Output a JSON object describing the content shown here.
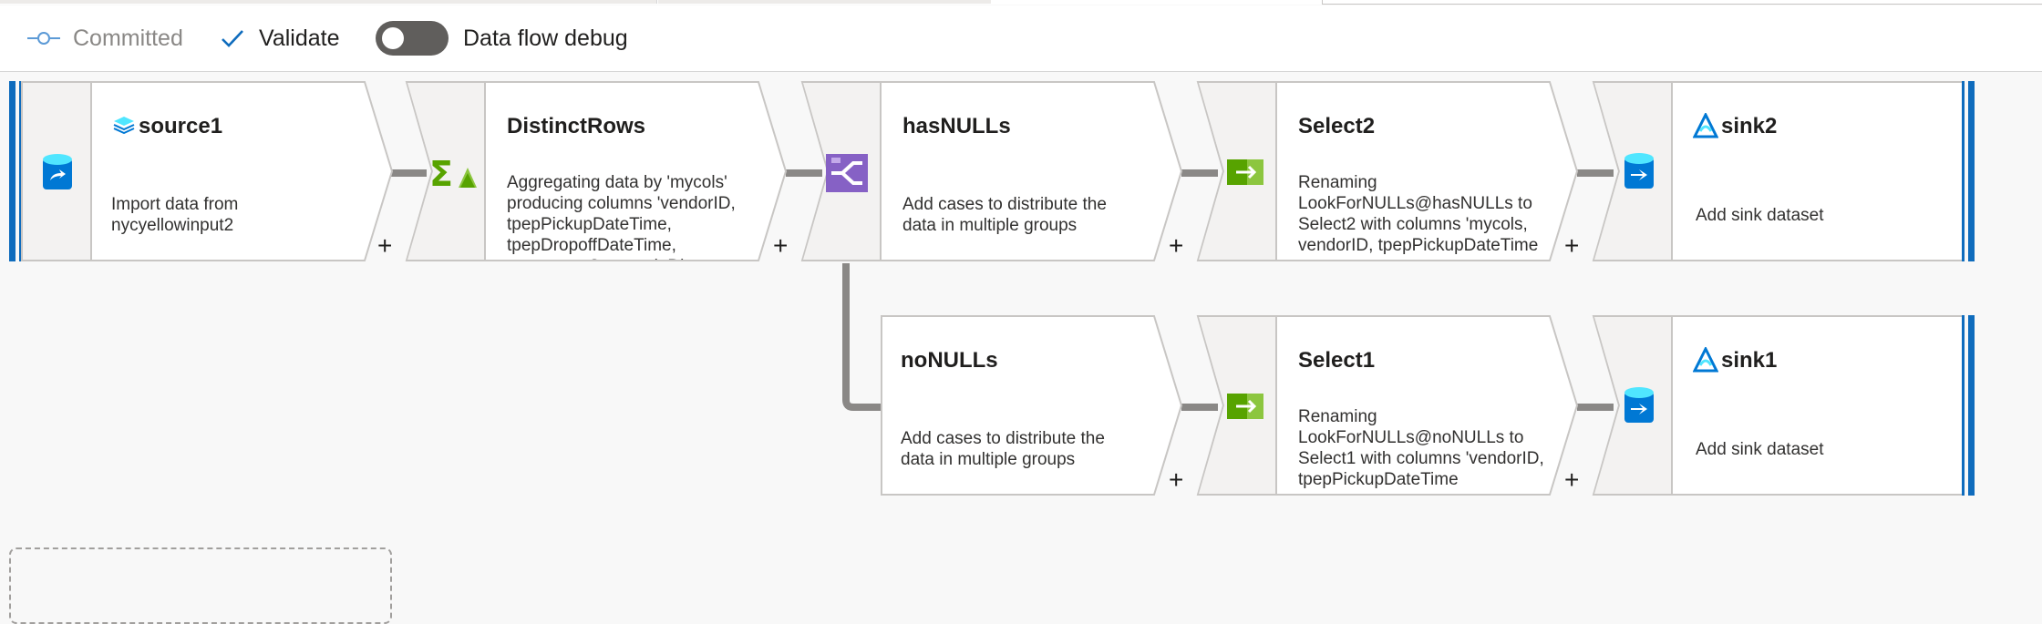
{
  "toolbar": {
    "committed_label": "Committed",
    "validate_label": "Validate",
    "debug_label": "Data flow debug",
    "debug_enabled": false
  },
  "nodes": {
    "source1": {
      "title": "source1",
      "desc": "Import data from nycyellowinput2",
      "icon": "source-dataset-icon",
      "title_icon": "dataset-layers-icon"
    },
    "distinct": {
      "title": "DistinctRows",
      "desc": "Aggregating data by 'mycols' producing columns 'vendorID, tpepPickupDateTime, tpepDropoffDateTime, passengerCount, tripDist",
      "icon": "aggregate-icon"
    },
    "hasnulls": {
      "title": "hasNULLs",
      "desc": "Add cases to distribute the data in multiple groups",
      "icon": "conditional-split-icon"
    },
    "select2": {
      "title": "Select2",
      "desc": "Renaming LookForNULLs@hasNULLs to Select2 with columns 'mycols, vendorID, tpepPickupDateTime",
      "icon": "select-icon"
    },
    "sink2": {
      "title": "sink2",
      "desc": "Add sink dataset",
      "icon": "sink-dataset-icon",
      "title_icon": "synapse-icon"
    },
    "nonulls": {
      "title": "noNULLs",
      "desc": "Add cases to distribute the data in multiple groups"
    },
    "select1": {
      "title": "Select1",
      "desc": "Renaming LookForNULLs@noNULLs to Select1 with columns 'vendorID, tpepPickupDateTime",
      "icon": "select-icon"
    },
    "sink1": {
      "title": "sink1",
      "desc": "Add sink dataset",
      "icon": "sink-dataset-icon",
      "title_icon": "synapse-icon"
    }
  },
  "plus_label": "+",
  "colors": {
    "accent_blue": "#0f6cbd",
    "connector": "#8a8886",
    "aggregate_green": "#57a300",
    "split_purple": "#8661c5",
    "dataset_blue": "#0078d4"
  }
}
